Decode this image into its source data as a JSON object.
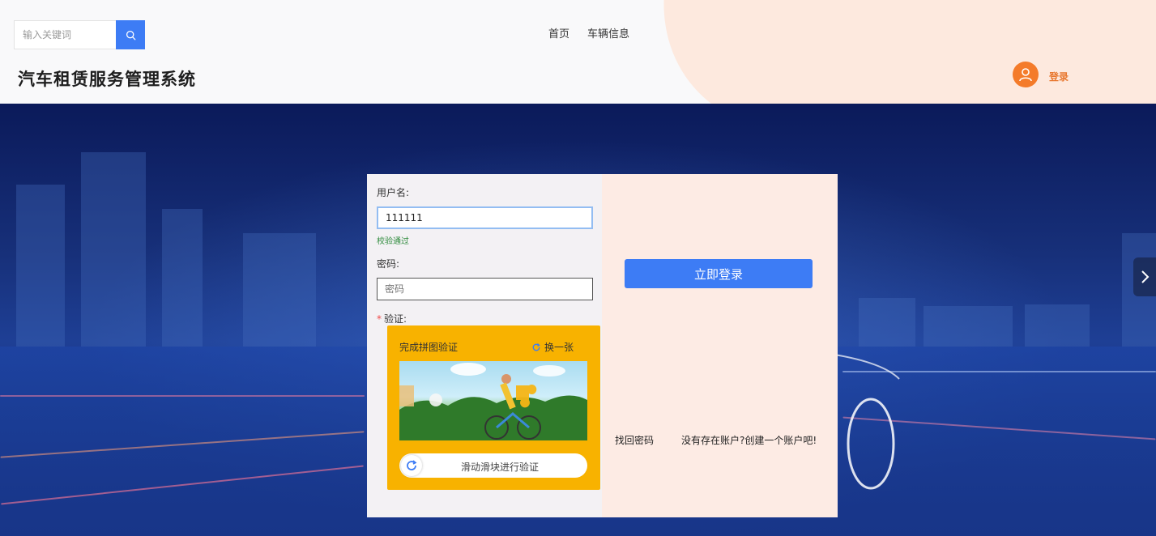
{
  "header": {
    "search": {
      "placeholder": "输入关键词"
    },
    "nav": [
      {
        "label": "首页"
      },
      {
        "label": "车辆信息"
      }
    ],
    "site_title": "汽车租赁服务管理系统",
    "login_label": "登录"
  },
  "login_form": {
    "username_label": "用户名:",
    "username_value": "111111",
    "username_hint": "校验通过",
    "password_label": "密码:",
    "password_placeholder": "密码",
    "captcha_label": "验证:",
    "captcha": {
      "title": "完成拼图验证",
      "refresh_label": "换一张",
      "slider_text": "滑动滑块进行验证"
    },
    "submit_label": "立即登录",
    "forgot_label": "找回密码",
    "register_label": "没有存在账户?创建一个账户吧!"
  },
  "colors": {
    "primary": "#3d7cf5",
    "accent": "#e8772e",
    "captcha_bg": "#f8b200",
    "valid": "#2e8b3c"
  },
  "icons": [
    "search-icon",
    "user-avatar-icon",
    "chevron-right-icon",
    "refresh-icon"
  ]
}
